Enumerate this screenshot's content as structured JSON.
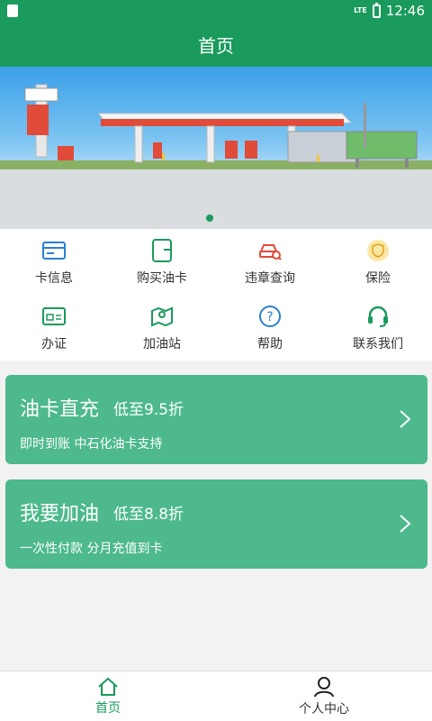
{
  "status": {
    "time": "12:46",
    "network": "LTE"
  },
  "appbar": {
    "title": "首页"
  },
  "banner": {
    "slide_count": 2,
    "active_slide": 1
  },
  "grid": {
    "items": [
      {
        "label": "卡信息",
        "icon": "card-icon"
      },
      {
        "label": "购买油卡",
        "icon": "wallet-icon"
      },
      {
        "label": "违章查询",
        "icon": "car-search-icon"
      },
      {
        "label": "保险",
        "icon": "shield-icon"
      },
      {
        "label": "办证",
        "icon": "id-card-icon"
      },
      {
        "label": "加油站",
        "icon": "map-location-icon"
      },
      {
        "label": "帮助",
        "icon": "help-icon"
      },
      {
        "label": "联系我们",
        "icon": "headset-icon"
      }
    ]
  },
  "cards": [
    {
      "title": "油卡直充",
      "discount": "低至9.5折",
      "subtitle": "即时到账 中石化油卡支持"
    },
    {
      "title": "我要加油",
      "discount": "低至8.8折",
      "subtitle": "一次性付款 分月充值到卡"
    }
  ],
  "tabbar": {
    "tabs": [
      {
        "label": "首页",
        "icon": "home-icon",
        "active": true
      },
      {
        "label": "个人中心",
        "icon": "user-icon",
        "active": false
      }
    ]
  },
  "colors": {
    "primary": "#1a9a5c",
    "card": "#4db98c",
    "accent_red": "#e04b3a",
    "accent_yellow": "#f3c43b",
    "icon_blue": "#2a7fd0"
  }
}
